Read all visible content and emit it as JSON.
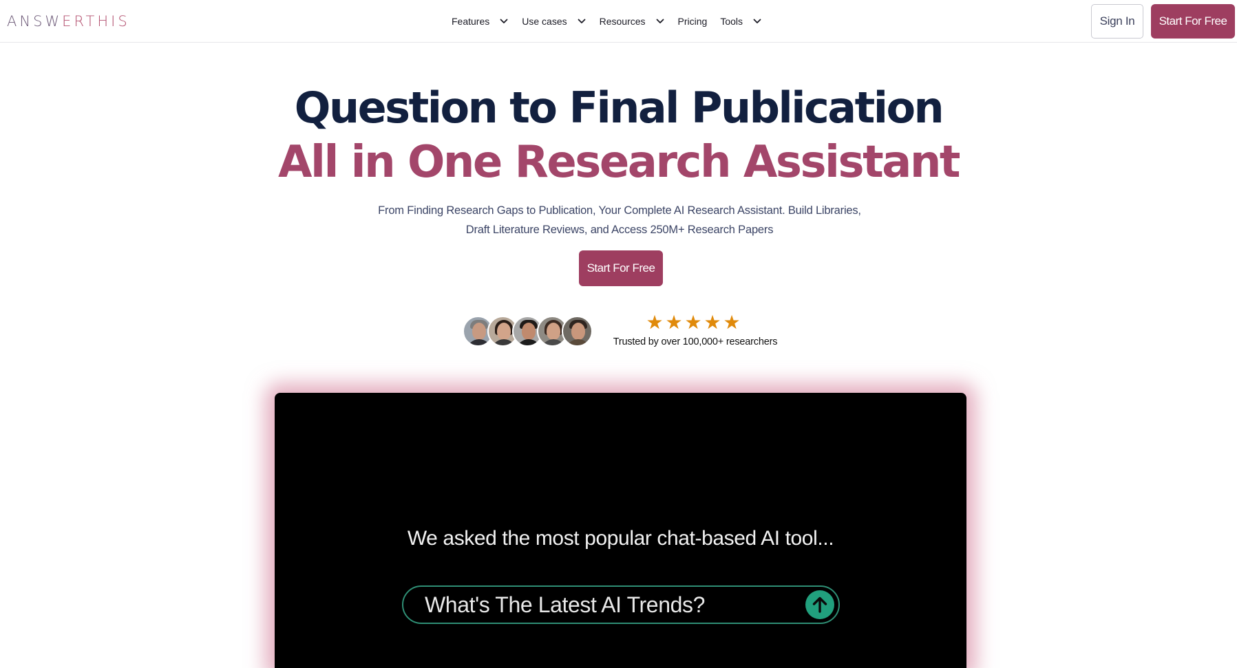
{
  "brand": {
    "logo_part_a": "ANSW",
    "logo_part_b": "ERTHIS"
  },
  "nav": {
    "items": [
      {
        "label": "Features",
        "has_dropdown": true
      },
      {
        "label": "Use cases",
        "has_dropdown": true
      },
      {
        "label": "Resources",
        "has_dropdown": true
      },
      {
        "label": "Pricing",
        "has_dropdown": false
      },
      {
        "label": "Tools",
        "has_dropdown": true
      }
    ],
    "signin_label": "Sign In",
    "start_label": "Start For Free"
  },
  "hero": {
    "title_line1": "Question to Final Publication",
    "title_line2": "All in One Research Assistant",
    "subtitle_line1": "From Finding Research Gaps to Publication, Your Complete AI Research Assistant. Build Libraries,",
    "subtitle_line2": "Draft Literature Reviews, and Access 250M+ Research Papers",
    "cta_label": "Start For Free"
  },
  "social_proof": {
    "rating_stars": 5,
    "star_glyph": "★",
    "trusted_text": "Trusted by over 100,000+ researchers"
  },
  "video": {
    "caption": "We asked the most popular chat-based AI tool...",
    "prompt_text": "What's The Latest AI Trends?",
    "send_icon": "arrow-up-icon"
  },
  "colors": {
    "brand_primary": "#9e3e60",
    "headline_dark": "#12203f",
    "headline_accent": "#a3466a",
    "star": "#e08a0b",
    "send_button": "#21a07d"
  }
}
